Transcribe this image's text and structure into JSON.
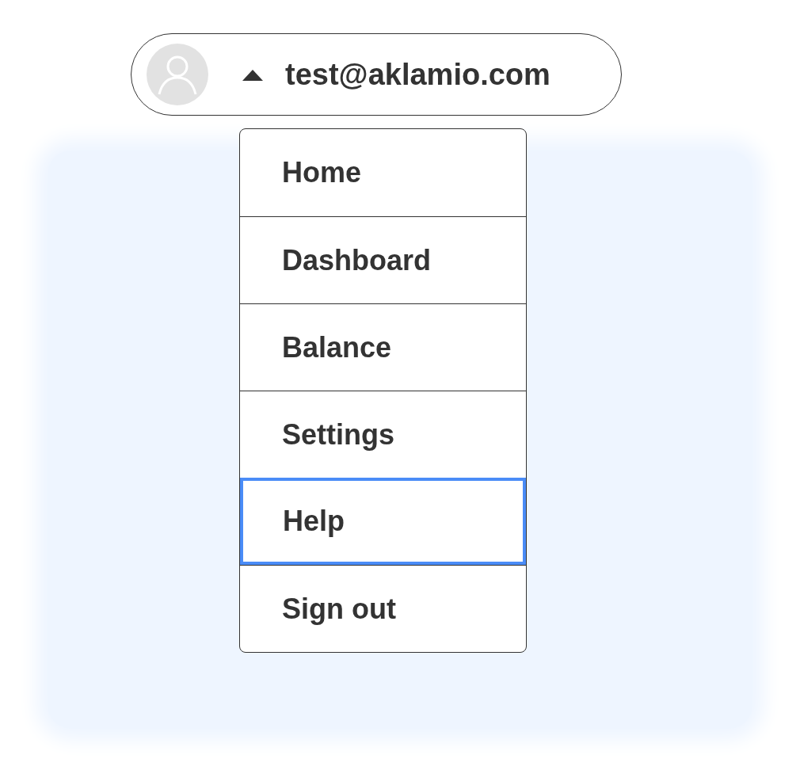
{
  "account": {
    "email": "test@aklamio.com",
    "expanded": true
  },
  "menu": [
    {
      "label": "Home",
      "focused": false
    },
    {
      "label": "Dashboard",
      "focused": false
    },
    {
      "label": "Balance",
      "focused": false
    },
    {
      "label": "Settings",
      "focused": false
    },
    {
      "label": "Help",
      "focused": true
    },
    {
      "label": "Sign out",
      "focused": false
    }
  ]
}
